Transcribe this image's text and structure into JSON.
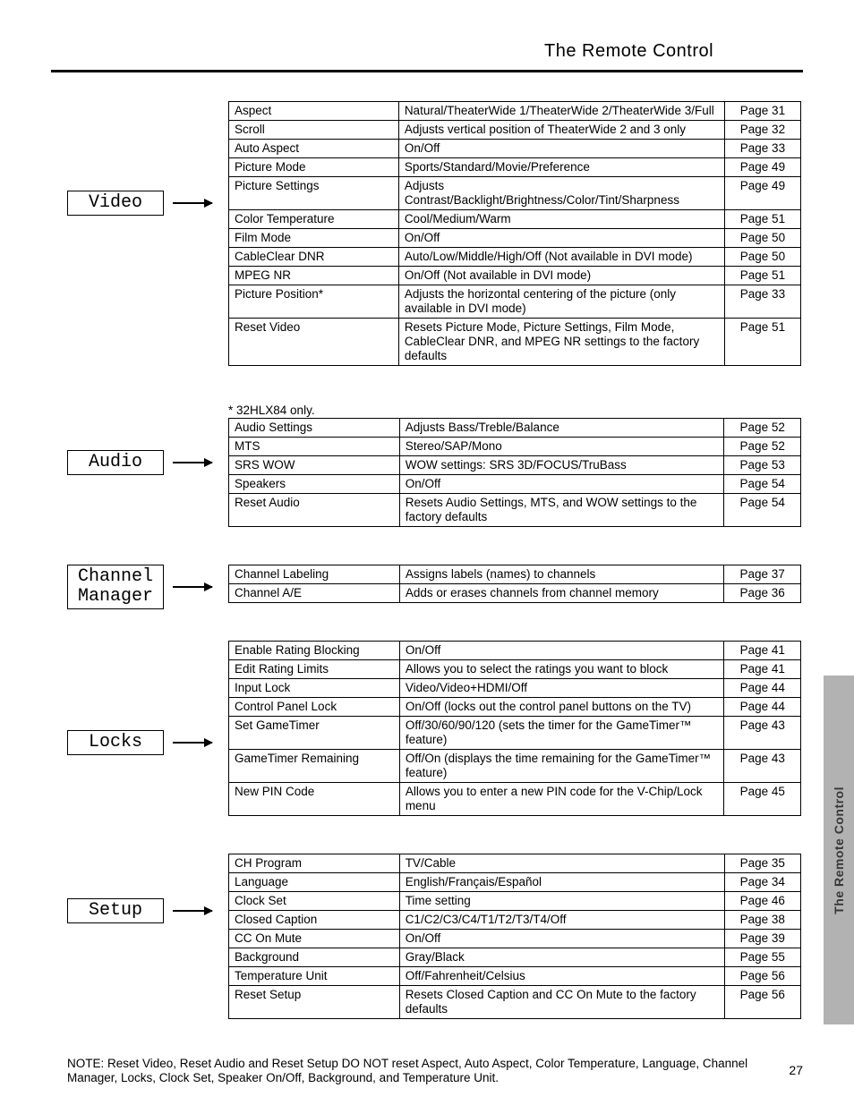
{
  "pageTitle": "The Remote Control",
  "pageNum": "27",
  "sideTab": "The Remote Control",
  "notes": {
    "modelLimit": "* 32HLX84 only.",
    "resetNote": "NOTE: Reset Video, Reset Audio and Reset Setup DO NOT reset Aspect, Auto Aspect, Color Temperature, Language, Channel Manager, Locks, Clock Set, Speaker On/Off, Background, and Temperature Unit."
  },
  "groups": [
    {
      "label": "Video",
      "boxTop": 100,
      "rows": [
        {
          "item": "Aspect",
          "desc": "Natural/TheaterWide 1/TheaterWide 2/TheaterWide 3/Full",
          "ref": "Page 31"
        },
        {
          "item": "Scroll",
          "desc": "Adjusts vertical position of TheaterWide 2 and 3 only",
          "ref": "Page 32"
        },
        {
          "item": "Auto Aspect",
          "desc": "On/Off",
          "ref": "Page 33"
        },
        {
          "item": "Picture Mode",
          "desc": "Sports/Standard/Movie/Preference",
          "ref": "Page 49"
        },
        {
          "item": "Picture Settings",
          "desc": "Adjusts Contrast/Backlight/Brightness/Color/Tint/Sharpness",
          "ref": "Page 49"
        },
        {
          "item": "Color Temperature",
          "desc": "Cool/Medium/Warm",
          "ref": "Page 51"
        },
        {
          "item": "Film Mode",
          "desc": "On/Off",
          "ref": "Page 50"
        },
        {
          "item": "CableClear DNR",
          "desc": "Auto/Low/Middle/High/Off (Not available in DVI mode)",
          "ref": "Page 50"
        },
        {
          "item": "MPEG NR",
          "desc": "On/Off (Not available in DVI mode)",
          "ref": "Page 51"
        },
        {
          "item": "Picture Position*",
          "desc": "Adjusts the horizontal centering of the picture (only available in DVI mode)",
          "ref": "Page 33"
        },
        {
          "item": "Reset Video",
          "desc": "Resets Picture Mode, Picture Settings, Film Mode, CableClear DNR, and MPEG NR settings to the factory defaults",
          "ref": "Page 51"
        }
      ]
    },
    {
      "label": "Audio",
      "boxTop": 36,
      "rows": [
        {
          "item": "Audio Settings",
          "desc": "Adjusts Bass/Treble/Balance",
          "ref": "Page 52"
        },
        {
          "item": "MTS",
          "desc": "Stereo/SAP/Mono",
          "ref": "Page 52"
        },
        {
          "item": "SRS WOW",
          "desc": "WOW settings: SRS 3D/FOCUS/TruBass",
          "ref": "Page 53"
        },
        {
          "item": "Speakers",
          "desc": "On/Off",
          "ref": "Page 54"
        },
        {
          "item": "Reset Audio",
          "desc": "Resets Audio Settings, MTS, and WOW settings to the factory defaults",
          "ref": "Page 54"
        }
      ]
    },
    {
      "label": "Channel\nManager",
      "boxTop": 0,
      "rows": [
        {
          "item": "Channel Labeling",
          "desc": "Assigns labels (names) to channels",
          "ref": "Page 37"
        },
        {
          "item": "Channel A/E",
          "desc": "Adds or erases channels from channel memory",
          "ref": "Page 36"
        }
      ]
    },
    {
      "label": "Locks",
      "boxTop": 100,
      "rows": [
        {
          "item": "Enable Rating Blocking",
          "desc": "On/Off",
          "ref": "Page 41"
        },
        {
          "item": "Edit Rating Limits",
          "desc": "Allows you to select the ratings you want to block",
          "ref": "Page 41"
        },
        {
          "item": "Input Lock",
          "desc": "Video/Video+HDMI/Off",
          "ref": "Page 44"
        },
        {
          "item": "Control Panel Lock",
          "desc": "On/Off (locks out the control panel buttons on the TV)",
          "ref": "Page 44"
        },
        {
          "item": "Set GameTimer",
          "desc": "Off/30/60/90/120 (sets the timer for the GameTimer™ feature)",
          "ref": "Page 43"
        },
        {
          "item": "GameTimer Remaining",
          "desc": "Off/On (displays the time remaining for the GameTimer™ feature)",
          "ref": "Page 43"
        },
        {
          "item": "New PIN Code",
          "desc": "Allows you to enter a new PIN code for the V-Chip/Lock menu",
          "ref": "Page 45"
        }
      ]
    },
    {
      "label": "Setup",
      "boxTop": 50,
      "rows": [
        {
          "item": "CH Program",
          "desc": "TV/Cable",
          "ref": "Page 35"
        },
        {
          "item": "Language",
          "desc": "English/Français/Español",
          "ref": "Page 34"
        },
        {
          "item": "Clock Set",
          "desc": "Time setting",
          "ref": "Page 46"
        },
        {
          "item": "Closed Caption",
          "desc": "C1/C2/C3/C4/T1/T2/T3/T4/Off",
          "ref": "Page 38"
        },
        {
          "item": "CC On Mute",
          "desc": "On/Off",
          "ref": "Page 39"
        },
        {
          "item": "Background",
          "desc": "Gray/Black",
          "ref": "Page 55"
        },
        {
          "item": "Temperature Unit",
          "desc": "Off/Fahrenheit/Celsius",
          "ref": "Page 56"
        },
        {
          "item": "Reset Setup",
          "desc": "Resets Closed Caption and CC On Mute to the factory defaults",
          "ref": "Page 56"
        }
      ]
    }
  ]
}
